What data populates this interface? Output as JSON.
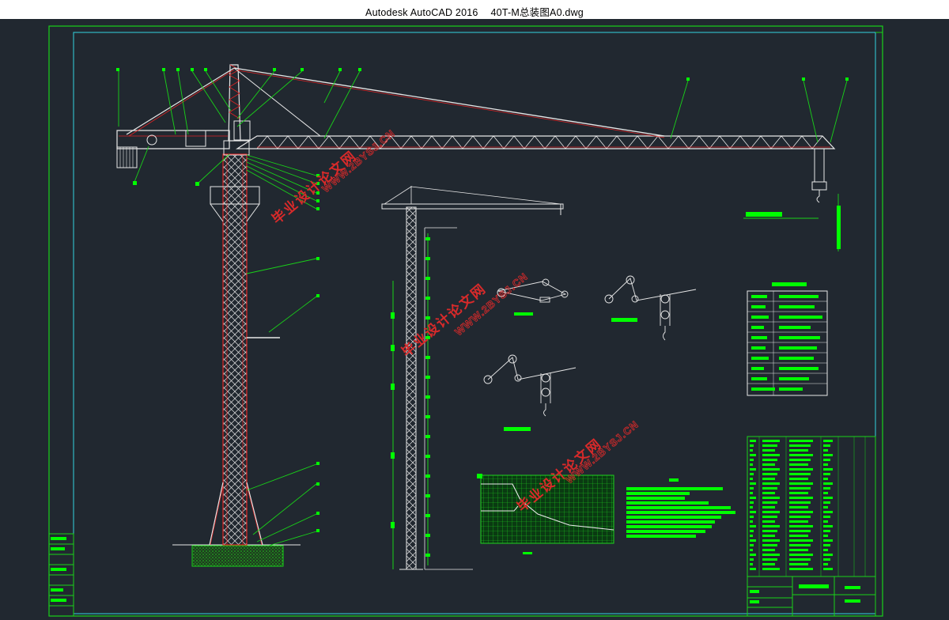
{
  "window": {
    "app_name": "Autodesk AutoCAD 2016",
    "file_name": "40T-M总装图A0.dwg"
  },
  "watermarks": [
    {
      "text": "毕业设计论文网",
      "url": "WWW.2BYSJ.CN"
    },
    {
      "text": "毕业设计论文网",
      "url": "WWW.2BYSJ.CN"
    },
    {
      "text": "毕业设计论文网",
      "url": "WWW.2BYSJ.CN"
    }
  ],
  "colors": {
    "canvas_bg": "#212830",
    "frame": "#19d219",
    "inner_frame": "#33d4e0",
    "structure_white": "#e8e8e8",
    "structure_red": "#e02424",
    "highlight_green": "#00ff00",
    "watermark_red": "#d92a2a"
  }
}
